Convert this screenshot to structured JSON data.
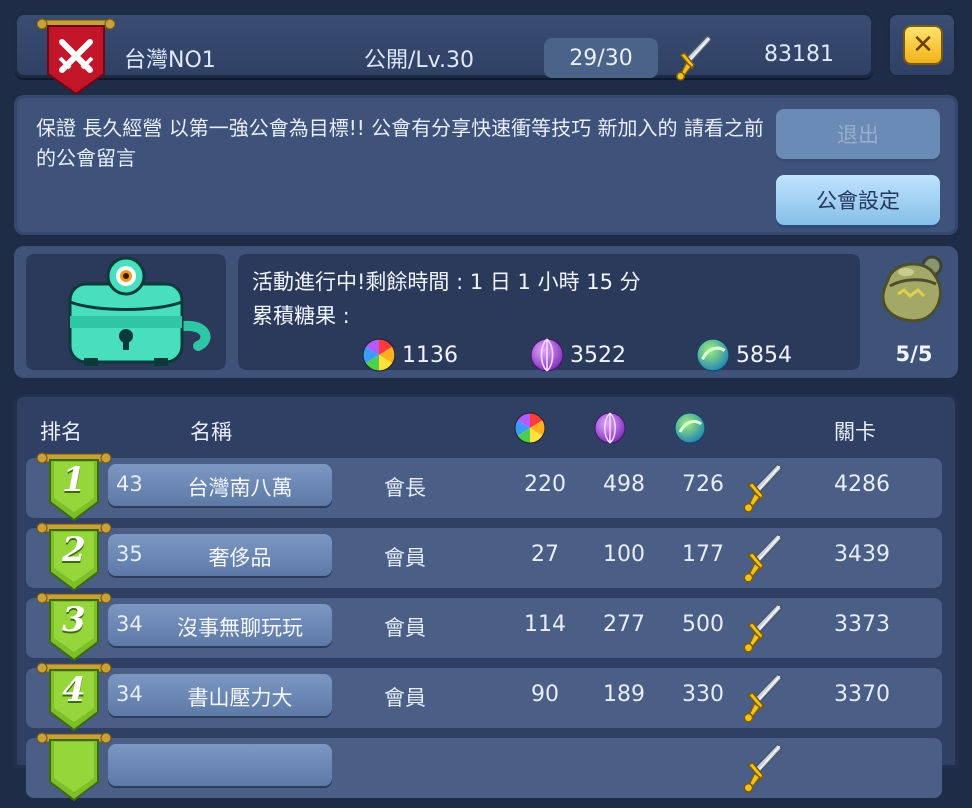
{
  "header": {
    "guild_name": "台灣NO1",
    "guild_level": "公開/Lv.30",
    "member_count": "29/30",
    "power": "83181",
    "banner_icon": "guild-banner-icon",
    "sword_icon": "sword-icon",
    "close_icon": "close-icon"
  },
  "notice": {
    "text": "保證 長久經營 以第一強公會為目標!! 公會有分享快速衝等技巧 新加入的 請看之前的公會留言",
    "leave_label": "退出",
    "settings_label": "公會設定"
  },
  "event": {
    "time_text": "活動進行中!剩餘時間 : 1 日 1 小時 15 分",
    "candy_label": "累積糖果 :",
    "candies": [
      {
        "icon": "rainbow-candy-icon",
        "value": "1136"
      },
      {
        "icon": "purple-candy-icon",
        "value": "3522"
      },
      {
        "icon": "green-candy-icon",
        "value": "5854"
      }
    ],
    "bell_count": "5/5",
    "mascot_icon": "treasure-chest-monster-icon",
    "bell_icon": "bell-icon"
  },
  "ranking": {
    "columns": {
      "rank": "排名",
      "name": "名稱",
      "stage": "關卡"
    },
    "rows": [
      {
        "rank": "1",
        "level": "43",
        "name": "台灣南八萬",
        "role": "會長",
        "c1": "220",
        "c2": "498",
        "c3": "726",
        "stage": "4286"
      },
      {
        "rank": "2",
        "level": "35",
        "name": "奢侈品",
        "role": "會員",
        "c1": "27",
        "c2": "100",
        "c3": "177",
        "stage": "3439"
      },
      {
        "rank": "3",
        "level": "34",
        "name": "沒事無聊玩玩",
        "role": "會員",
        "c1": "114",
        "c2": "277",
        "c3": "500",
        "stage": "3373"
      },
      {
        "rank": "4",
        "level": "34",
        "name": "書山壓力大",
        "role": "會員",
        "c1": "90",
        "c2": "189",
        "c3": "330",
        "stage": "3370"
      }
    ]
  },
  "colors": {
    "background": "#1f2c47",
    "panel": "#3f5279",
    "row": "#4a5e86",
    "rank_badge": "#7cbf2a",
    "gold": "#f0b21b"
  }
}
